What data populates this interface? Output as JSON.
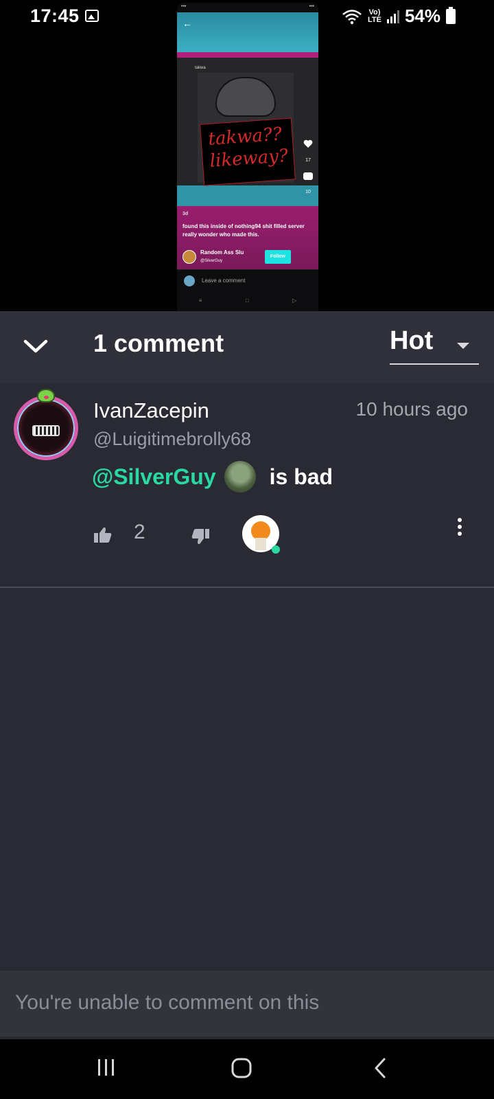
{
  "status_bar": {
    "time": "17:45",
    "lte": "Vo)\nLTE",
    "battery": "54%"
  },
  "preview": {
    "mini_user": "takwa",
    "mini_sign_line1": "takwa??",
    "mini_sign_line2": "likeway?",
    "like_count": "17",
    "comment_count": "10",
    "age": "3d",
    "caption": "found this inside of nothing94 shit filled server really wonder who made this.",
    "author_name": "Random Ass Slu",
    "author_handle": "@SilverGuy",
    "follow_label": "Follow",
    "comment_placeholder": "Leave a comment"
  },
  "header": {
    "comment_count": "1 comment",
    "sort": "Hot"
  },
  "comment": {
    "username": "IvanZacepin",
    "handle": "@Luigitimebrolly68",
    "time": "10 hours ago",
    "mention": "@SilverGuy",
    "text": "is bad",
    "likes": "2"
  },
  "footer": {
    "text": "You're unable to comment on this"
  },
  "colors": {
    "accent": "#2ad9a2",
    "sheet_bg": "#2a2a34",
    "header_bg": "#30303a"
  }
}
